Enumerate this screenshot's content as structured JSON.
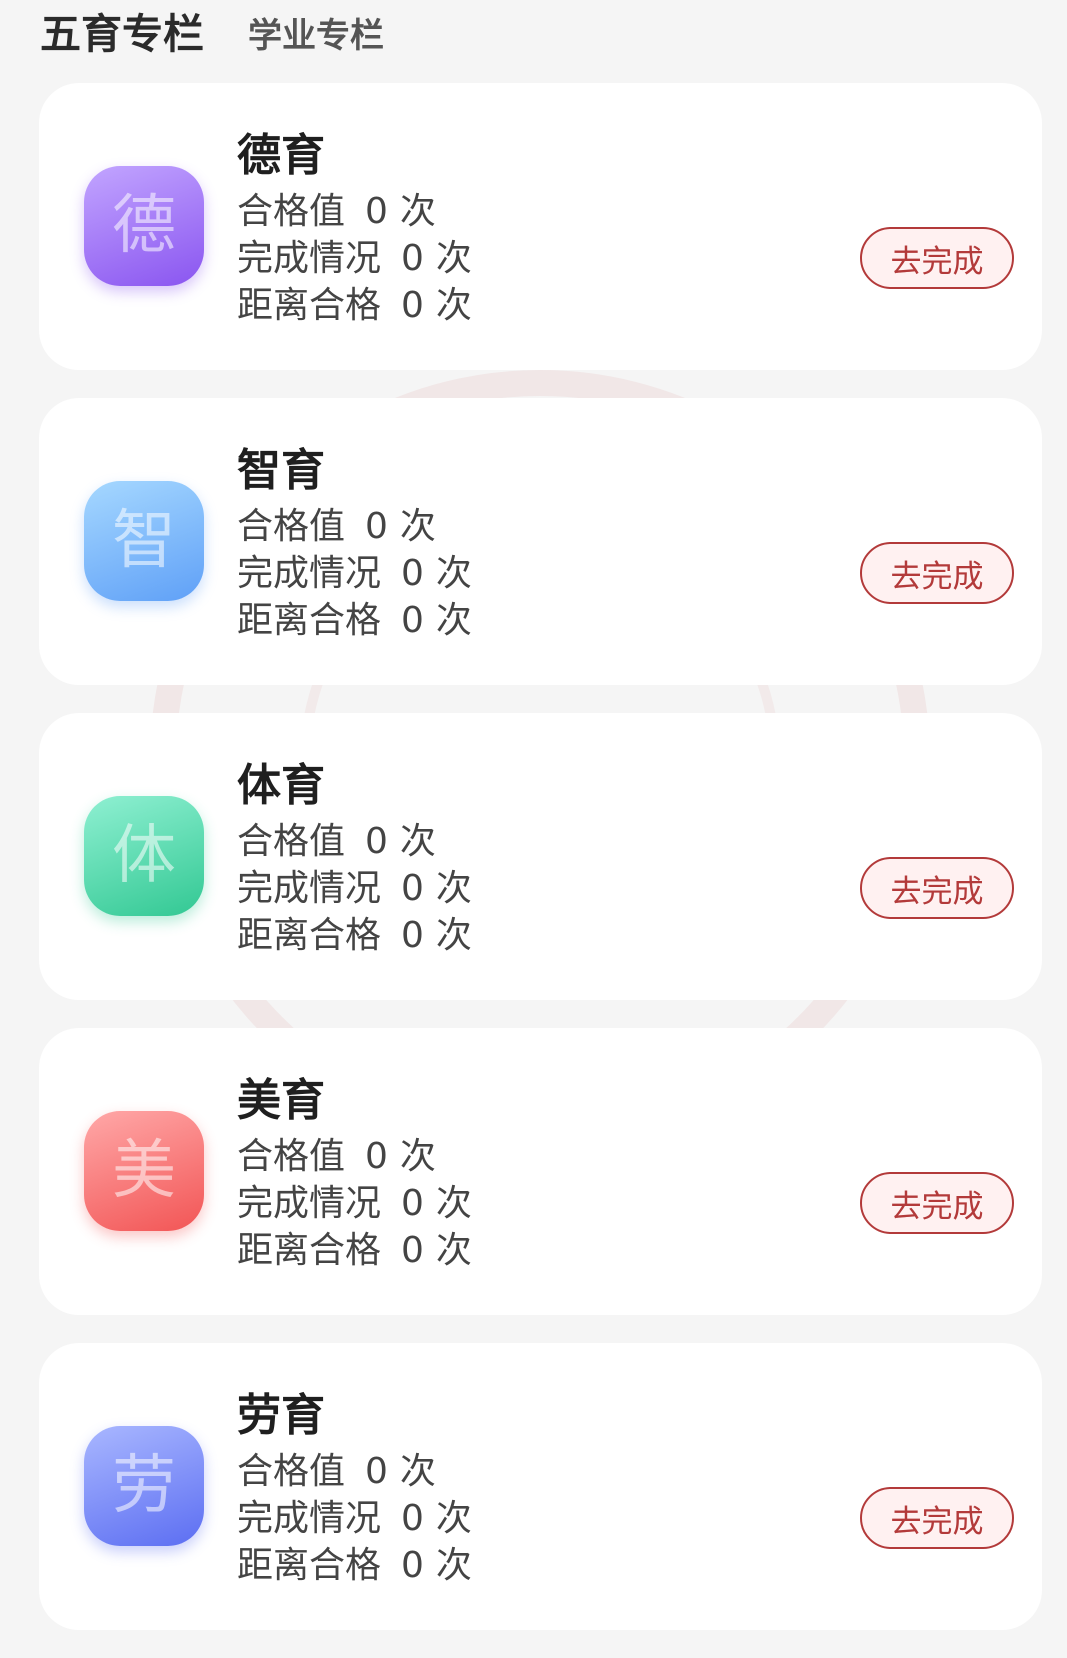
{
  "tabs": {
    "active": "五育专栏",
    "inactive": "学业专栏"
  },
  "stat_labels": {
    "qualified_value": "合格值",
    "completion": "完成情况",
    "remaining": "距离合格",
    "unit": "次"
  },
  "cards": [
    {
      "title": "德育",
      "icon_glyph": "德",
      "icon_name": "moral-education-seal-icon",
      "color_from": "#c2a5ff",
      "color_to": "#8a55f0",
      "qualified_value": "0",
      "completion": "0",
      "remaining": "0",
      "button_label": "去完成"
    },
    {
      "title": "智育",
      "icon_glyph": "智",
      "icon_name": "intellectual-education-seal-icon",
      "color_from": "#a6d8ff",
      "color_to": "#5fa0f7",
      "qualified_value": "0",
      "completion": "0",
      "remaining": "0",
      "button_label": "去完成"
    },
    {
      "title": "体育",
      "icon_glyph": "体",
      "icon_name": "physical-education-seal-icon",
      "color_from": "#8ff0d2",
      "color_to": "#32c893",
      "qualified_value": "0",
      "completion": "0",
      "remaining": "0",
      "button_label": "去完成"
    },
    {
      "title": "美育",
      "icon_glyph": "美",
      "icon_name": "aesthetic-education-seal-icon",
      "color_from": "#ffa8a8",
      "color_to": "#f25555",
      "qualified_value": "0",
      "completion": "0",
      "remaining": "0",
      "button_label": "去完成"
    },
    {
      "title": "劳育",
      "icon_glyph": "劳",
      "icon_name": "labor-education-seal-icon",
      "color_from": "#a9b7ff",
      "color_to": "#5c6ef2",
      "qualified_value": "0",
      "completion": "0",
      "remaining": "0",
      "button_label": "去完成"
    }
  ]
}
